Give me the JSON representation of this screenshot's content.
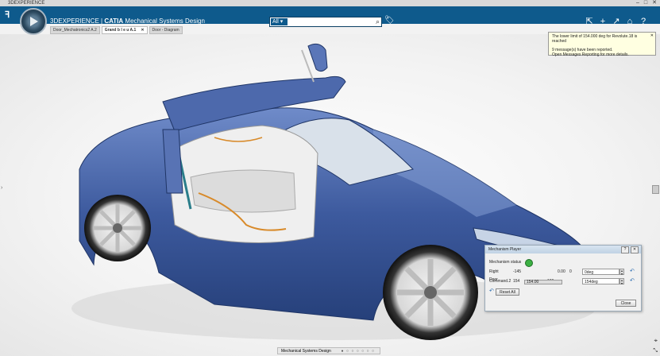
{
  "window": {
    "title": "3DEXPERIENCE",
    "controls": [
      "–",
      "□",
      "✕"
    ]
  },
  "topbar": {
    "brand": "3DEXPERIENCE",
    "separator": " | ",
    "product": "CATIA",
    "app": "Mechanical Systems Design",
    "search": {
      "scope": "All ▾",
      "placeholder": "",
      "icon": "search-icon"
    },
    "tools": [
      "⇱",
      "+",
      "↗",
      "⌂",
      "?"
    ],
    "tag_icon": "tag-icon"
  },
  "tabs": [
    {
      "label": "Door_Mechatronics2 A.2",
      "active": false,
      "closable": false
    },
    {
      "label": "Grand b l e u A.1",
      "active": true,
      "closable": true
    },
    {
      "label": "Door - Diagram",
      "active": false,
      "closable": false
    }
  ],
  "notification": {
    "line1": "The lower limit of 154.000 deg for Revolute.18 is reached",
    "line2": "9 message(s) have been reported.",
    "line3": "Open Messages Reporting for more details."
  },
  "dialog": {
    "title": "Mechanism Player",
    "status_label": "Mechanism status",
    "rows": [
      {
        "name": "Right Door",
        "min": "-145",
        "current": "0.00",
        "max": "0",
        "field": "0deg"
      },
      {
        "name": "Command.2",
        "min": "154",
        "current": "154.00",
        "max": "180",
        "field": "154deg"
      }
    ],
    "reset_label": "Reset All",
    "close_label": "Close",
    "slider_level": 0
  },
  "statusbar": {
    "label": "Mechanical Systems Design",
    "dots": "● ○ ○ ○ ○ ○ ○"
  },
  "colors": {
    "topbar": "#0e5a8c",
    "car_body": "#3d5a9e",
    "status_ok": "#3cb043",
    "notification_bg": "#ffffe1"
  }
}
